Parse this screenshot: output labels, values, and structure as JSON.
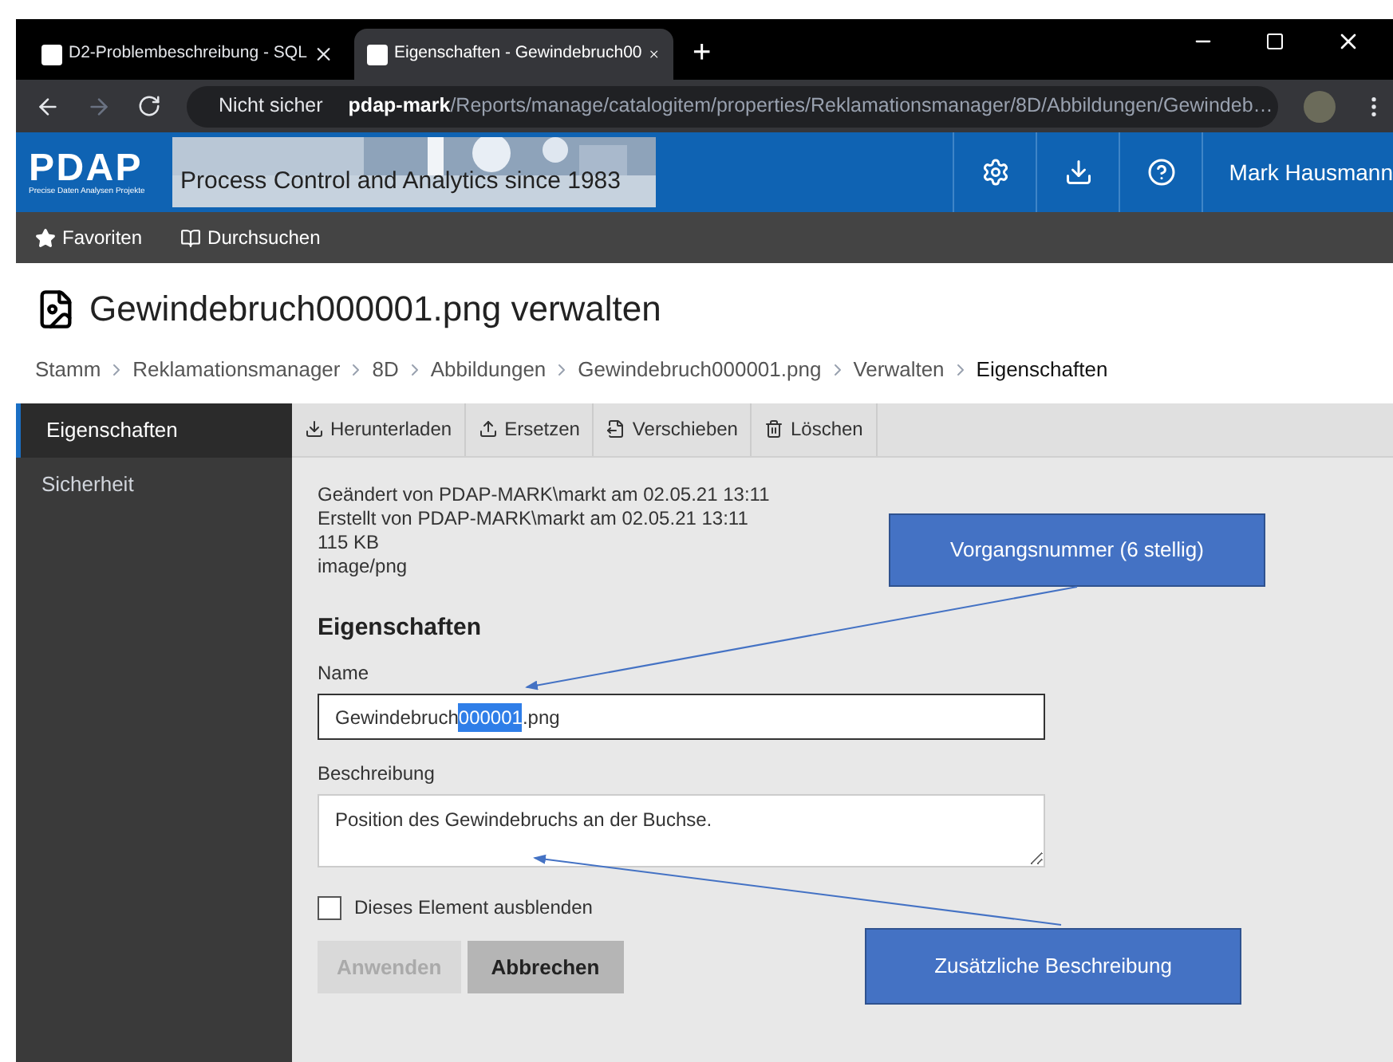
{
  "browser_tabs": [
    {
      "title": "D2-Problembeschreibung - SQL",
      "selected": false
    },
    {
      "title": "Eigenschaften - Gewindebruch00",
      "selected": true
    }
  ],
  "new_tab": "+",
  "address": {
    "security": "Nicht sicher",
    "host": "pdap-mark",
    "path": "/Reports/manage/catalogitem/properties/Reklamationsmanager/8D/Abbildungen/Gewindeb…"
  },
  "header": {
    "logo": "PDAP",
    "logo_tagline": "Precise Daten Analysen Projekte",
    "banner_text": "Process Control and Analytics since 1983",
    "user": "Mark Hausmann"
  },
  "nav": [
    "Favoriten",
    "Durchsuchen"
  ],
  "page_title": "Gewindebruch000001.png verwalten",
  "breadcrumbs": [
    {
      "label": "Stamm",
      "current": false
    },
    {
      "label": "Reklamationsmanager",
      "current": false
    },
    {
      "label": "8D",
      "current": false
    },
    {
      "label": "Abbildungen",
      "current": false
    },
    {
      "label": "Gewindebruch000001.png",
      "current": false
    },
    {
      "label": "Verwalten",
      "current": false
    },
    {
      "label": "Eigenschaften",
      "current": true
    }
  ],
  "sidebar": [
    {
      "label": "Eigenschaften",
      "selected": true
    },
    {
      "label": "Sicherheit",
      "selected": false
    }
  ],
  "toolbar": [
    {
      "kind": "download",
      "label": "Herunterladen"
    },
    {
      "kind": "upload",
      "label": "Ersetzen"
    },
    {
      "kind": "move",
      "label": "Verschieben"
    },
    {
      "kind": "delete",
      "label": "Löschen"
    }
  ],
  "meta": [
    "Geändert von PDAP-MARK\\markt am 02.05.21 13:11",
    "Erstellt von PDAP-MARK\\markt am 02.05.21 13:11",
    "115 KB",
    "image/png"
  ],
  "section_title": "Eigenschaften",
  "name_field": {
    "label": "Name",
    "value_before": "Gewindebruch",
    "value_selected": "000001",
    "value_after": ".png"
  },
  "description_field": {
    "label": "Beschreibung",
    "value": "Position des Gewindebruchs an der Buchse."
  },
  "hide_checkbox": {
    "label": "Dieses Element ausblenden",
    "checked": false
  },
  "buttons": [
    {
      "label": "Anwenden",
      "disabled": true
    },
    {
      "label": "Abbrechen",
      "disabled": false
    }
  ],
  "callouts": [
    "Vorgangsnummer (6 stellig)",
    "Zusätzliche Beschreibung"
  ]
}
